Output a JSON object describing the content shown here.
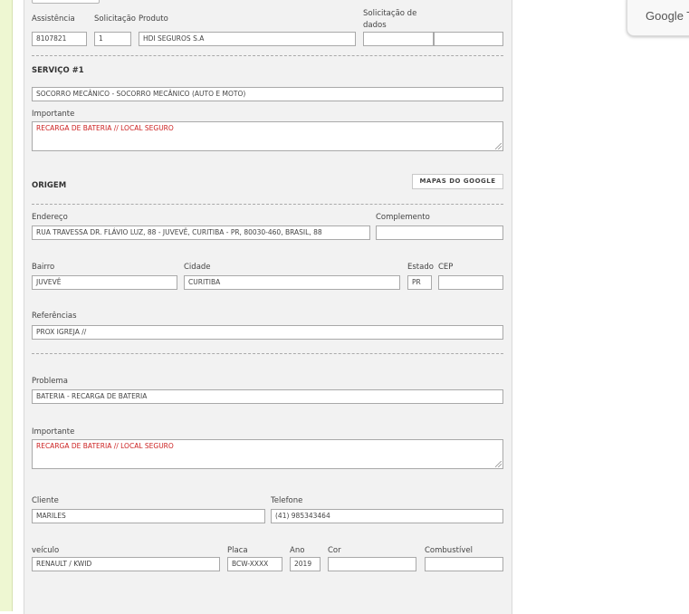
{
  "header": {
    "assistencia_label": "Assistência",
    "solicitacao_label": "Solicitação",
    "produto_label": "Produto",
    "solicitacao_dados_label_1": "Solicitação de",
    "solicitacao_dados_label_2": "dados",
    "assistencia_value": "8107821",
    "solicitacao_value": "1",
    "produto_value": "HDI SEGUROS S.A",
    "solicitacao_dados_value_a": "",
    "solicitacao_dados_value_b": ""
  },
  "servico": {
    "title": "SERVIÇO #1",
    "service_value": "SOCORRO MECÂNICO - SOCORRO MECÂNICO (AUTO E MOTO)",
    "importante_label": "Importante",
    "importante_value": "RECARGA DE BATERIA // LOCAL SEGURO"
  },
  "origem": {
    "title": "ORIGEM",
    "maps_button": "MAPAS DO GOOGLE",
    "endereco_label": "Endereço",
    "endereco_value": "RUA TRAVESSA DR. FLÁVIO LUZ, 88 - JUVEVÊ, CURITIBA - PR, 80030-460, BRASIL, 88",
    "complemento_label": "Complemento",
    "complemento_value": "",
    "bairro_label": "Bairro",
    "bairro_value": "JUVEVÊ",
    "cidade_label": "Cidade",
    "cidade_value": "CURITIBA",
    "estado_label": "Estado",
    "estado_value": "PR",
    "cep_label": "CEP",
    "cep_value": "",
    "referencias_label": "Referências",
    "referencias_value": "PROX IGREJA //"
  },
  "problema": {
    "problema_label": "Problema",
    "problema_value": "BATERIA - RECARGA DE BATERIA",
    "importante_label": "Importante",
    "importante_value": "RECARGA DE BATERIA // LOCAL SEGURO"
  },
  "cliente": {
    "cliente_label": "Cliente",
    "cliente_value": "MARILES",
    "telefone_label": "Telefone",
    "telefone_value": "(41) 985343464"
  },
  "veiculo": {
    "veiculo_label": "veículo",
    "veiculo_value": "RENAULT / KWID",
    "placa_label": "Placa",
    "placa_value": "BCW-XXXX",
    "ano_label": "Ano",
    "ano_value": "2019",
    "cor_label": "Cor",
    "cor_value": "",
    "combustivel_label": "Combustível",
    "combustivel_value": ""
  },
  "translate_popup": {
    "text": "Google T"
  }
}
